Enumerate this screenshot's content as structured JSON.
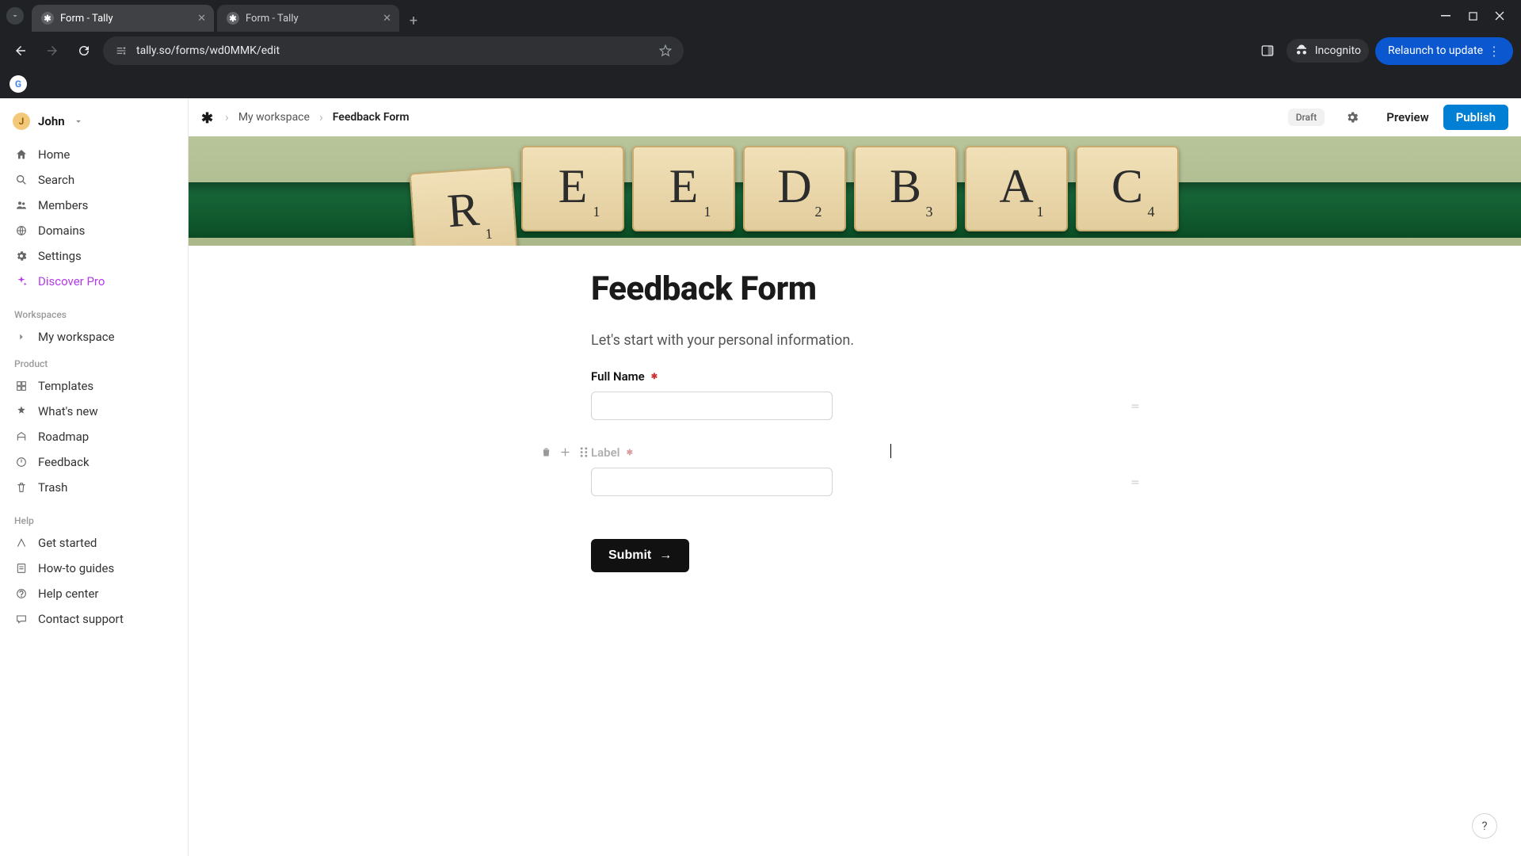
{
  "browser": {
    "tabs": [
      {
        "title": "Form - Tally",
        "active": true
      },
      {
        "title": "Form - Tally",
        "active": false
      }
    ],
    "url": "tally.so/forms/wd0MMK/edit",
    "incognito": "Incognito",
    "relaunch": "Relaunch to update",
    "bookmark_glyph": "G"
  },
  "sidebar": {
    "user_initial": "J",
    "user_name": "John",
    "main": [
      {
        "icon": "home",
        "label": "Home"
      },
      {
        "icon": "search",
        "label": "Search"
      },
      {
        "icon": "members",
        "label": "Members"
      },
      {
        "icon": "domains",
        "label": "Domains"
      },
      {
        "icon": "settings",
        "label": "Settings"
      },
      {
        "icon": "sparkle",
        "label": "Discover Pro",
        "pro": true
      }
    ],
    "workspaces_label": "Workspaces",
    "workspace_item": "My workspace",
    "product_label": "Product",
    "product": [
      {
        "icon": "templates",
        "label": "Templates"
      },
      {
        "icon": "whatsnew",
        "label": "What's new"
      },
      {
        "icon": "roadmap",
        "label": "Roadmap"
      },
      {
        "icon": "feedback",
        "label": "Feedback"
      },
      {
        "icon": "trash",
        "label": "Trash"
      }
    ],
    "help_label": "Help",
    "help": [
      {
        "icon": "getstarted",
        "label": "Get started"
      },
      {
        "icon": "guides",
        "label": "How-to guides"
      },
      {
        "icon": "helpcenter",
        "label": "Help center"
      },
      {
        "icon": "contact",
        "label": "Contact support"
      }
    ]
  },
  "topbar": {
    "crumb_workspace": "My workspace",
    "crumb_page": "Feedback Form",
    "draft": "Draft",
    "preview": "Preview",
    "publish": "Publish"
  },
  "cover_tiles": [
    "R",
    "E",
    "E",
    "D",
    "B",
    "A",
    "C"
  ],
  "cover_scores": [
    "1",
    "1",
    "1",
    "2",
    "3",
    "1",
    "4"
  ],
  "form": {
    "title": "Feedback Form",
    "intro": "Let's start with your personal information.",
    "field1_label": "Full Name",
    "field2_label": "Label",
    "submit": "Submit"
  },
  "help_fab": "?"
}
